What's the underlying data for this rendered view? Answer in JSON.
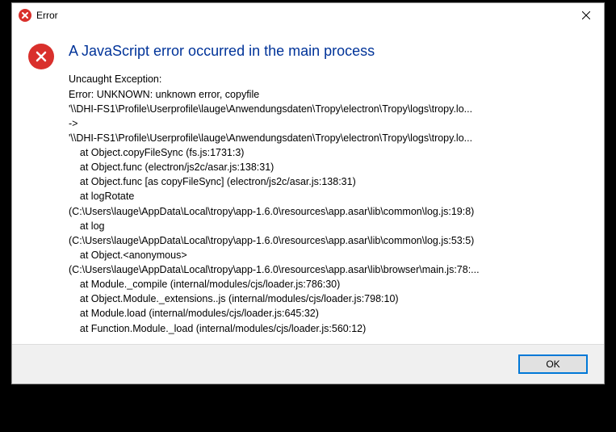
{
  "titlebar": {
    "title": "Error"
  },
  "dialog": {
    "heading": "A JavaScript error occurred in the main process",
    "body": "Uncaught Exception:\nError: UNKNOWN: unknown error, copyfile\n'\\\\DHI-FS1\\Profile\\Userprofile\\lauge\\Anwendungsdaten\\Tropy\\electron\\Tropy\\logs\\tropy.lo...\n->\n'\\\\DHI-FS1\\Profile\\Userprofile\\lauge\\Anwendungsdaten\\Tropy\\electron\\Tropy\\logs\\tropy.lo...\n    at Object.copyFileSync (fs.js:1731:3)\n    at Object.func (electron/js2c/asar.js:138:31)\n    at Object.func [as copyFileSync] (electron/js2c/asar.js:138:31)\n    at logRotate\n(C:\\Users\\lauge\\AppData\\Local\\tropy\\app-1.6.0\\resources\\app.asar\\lib\\common\\log.js:19:8)\n    at log\n(C:\\Users\\lauge\\AppData\\Local\\tropy\\app-1.6.0\\resources\\app.asar\\lib\\common\\log.js:53:5)\n    at Object.<anonymous>\n(C:\\Users\\lauge\\AppData\\Local\\tropy\\app-1.6.0\\resources\\app.asar\\lib\\browser\\main.js:78:...\n    at Module._compile (internal/modules/cjs/loader.js:786:30)\n    at Object.Module._extensions..js (internal/modules/cjs/loader.js:798:10)\n    at Module.load (internal/modules/cjs/loader.js:645:32)\n    at Function.Module._load (internal/modules/cjs/loader.js:560:12)"
  },
  "buttons": {
    "ok": "OK"
  }
}
